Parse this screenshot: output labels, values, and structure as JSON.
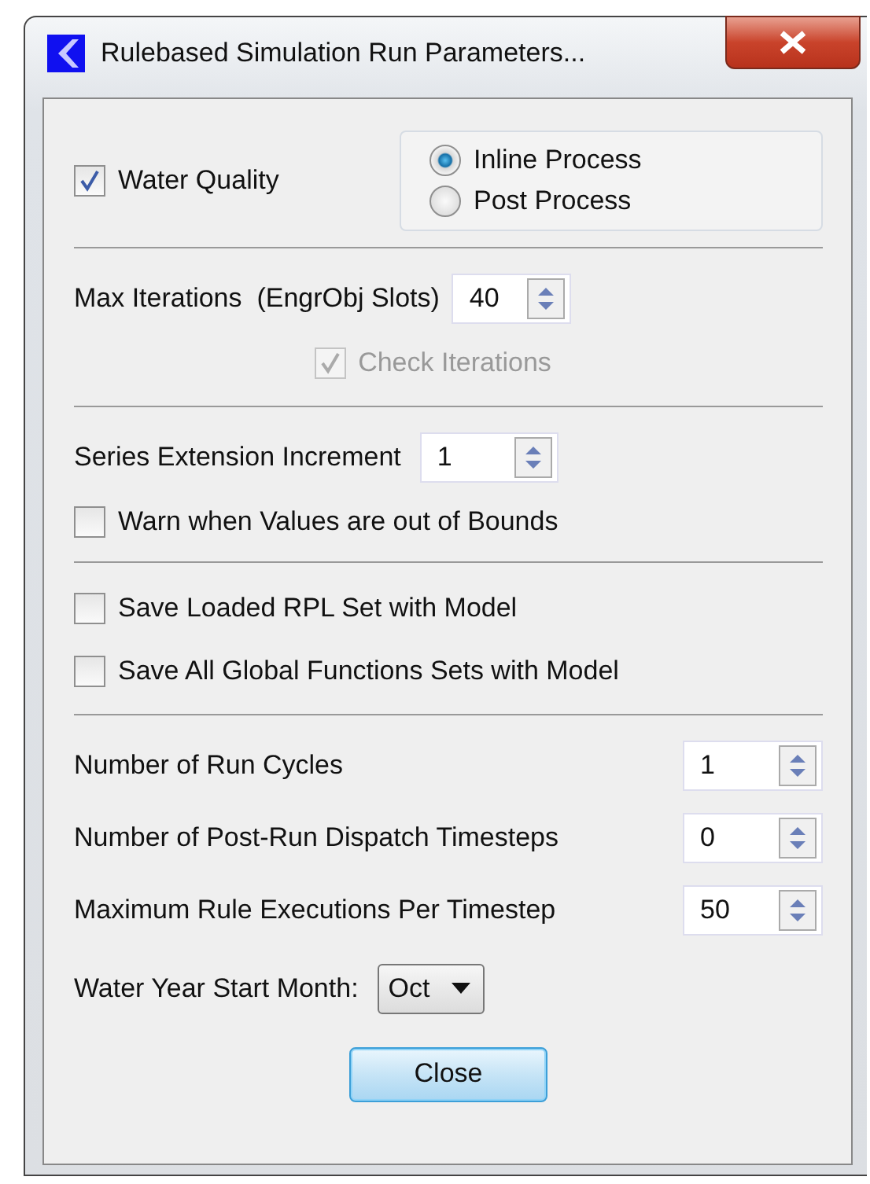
{
  "window": {
    "title": "Rulebased Simulation Run Parameters..."
  },
  "water_quality": {
    "label": "Water Quality",
    "checked": true,
    "disabled": false
  },
  "process_options": [
    {
      "label": "Inline Process",
      "selected": true
    },
    {
      "label": "Post Process",
      "selected": false
    }
  ],
  "max_iterations": {
    "label": "Max Iterations  (EngrObj Slots)",
    "value": "40"
  },
  "check_iterations": {
    "label": "Check Iterations",
    "checked": true,
    "disabled": true
  },
  "series_extension": {
    "label": "Series Extension Increment",
    "value": "1"
  },
  "warn_bounds": {
    "label": "Warn when Values are out of Bounds",
    "checked": false,
    "disabled": false
  },
  "save_options": [
    {
      "label": "Save Loaded RPL Set with Model",
      "checked": false,
      "disabled": false
    },
    {
      "label": "Save All Global Functions Sets with Model",
      "checked": false,
      "disabled": false
    }
  ],
  "run_settings": [
    {
      "label": "Number of Run Cycles",
      "value": "1"
    },
    {
      "label": "Number of Post-Run Dispatch Timesteps",
      "value": "0"
    },
    {
      "label": "Maximum Rule Executions Per Timestep",
      "value": "50"
    }
  ],
  "water_year": {
    "label": "Water Year Start Month:",
    "value": "Oct"
  },
  "close_button": {
    "label": "Close"
  }
}
